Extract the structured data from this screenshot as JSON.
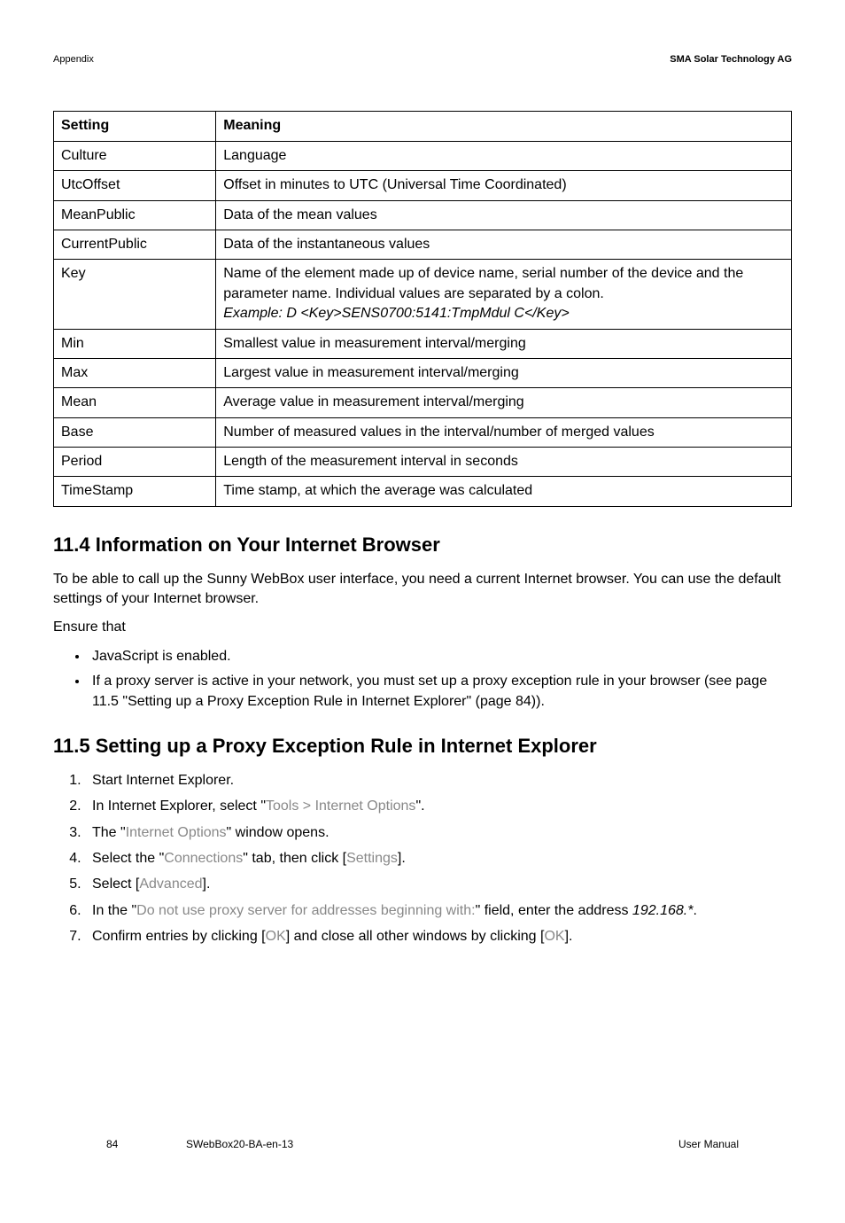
{
  "header": {
    "left": "Appendix",
    "right": "SMA Solar Technology AG"
  },
  "table": {
    "head": {
      "c1": "Setting",
      "c2": "Meaning"
    },
    "rows": [
      {
        "c1": "Culture",
        "c2": "Language"
      },
      {
        "c1": "UtcOffset",
        "c2": "Offset in minutes to UTC (Universal Time Coordinated)"
      },
      {
        "c1": "MeanPublic",
        "c2": "Data of the mean values"
      },
      {
        "c1": "CurrentPublic",
        "c2": "Data of the instantaneous values"
      },
      {
        "c1": "Key",
        "c2": "Name of the element made up of device name, serial number of the device and the parameter name. Individual values are separated by a colon.",
        "c2b": "Example: D <Key>SENS0700:5141:TmpMdul C</Key>"
      },
      {
        "c1": "Min",
        "c2": "Smallest value in measurement interval/merging"
      },
      {
        "c1": "Max",
        "c2": "Largest value in measurement interval/merging"
      },
      {
        "c1": "Mean",
        "c2": "Average value in measurement interval/merging"
      },
      {
        "c1": "Base",
        "c2": "Number of measured values in the interval/number of merged values"
      },
      {
        "c1": "Period",
        "c2": "Length of the measurement interval in seconds"
      },
      {
        "c1": "TimeStamp",
        "c2": "Time stamp, at which the average was calculated"
      }
    ]
  },
  "sec114": {
    "title": "11.4  Information on Your Internet Browser",
    "p1": "To be able to call up the Sunny WebBox user interface, you need a current Internet browser. You can use the default settings of your Internet browser.",
    "p2": "Ensure that",
    "b1": "JavaScript is enabled.",
    "b2": "If a proxy server is active in your network, you must set up a proxy exception rule in your browser (see page 11.5 \"Setting up a Proxy Exception Rule in Internet Explorer\" (page 84))."
  },
  "sec115": {
    "title": "11.5  Setting up a Proxy Exception Rule in Internet Explorer",
    "s1": "Start Internet Explorer.",
    "s2a": "In Internet Explorer, select \"",
    "s2b": "Tools > Internet Options",
    "s2c": "\".",
    "s3a": "The \"",
    "s3b": "Internet Options",
    "s3c": "\" window opens.",
    "s4a": "Select the \"",
    "s4b": "Connections",
    "s4c": "\" tab, then click [",
    "s4d": "Settings",
    "s4e": "].",
    "s5a": "Select [",
    "s5b": "Advanced",
    "s5c": "].",
    "s6a": "In the \"",
    "s6b": "Do not use proxy server for addresses beginning with:",
    "s6c": "\" field, enter the address ",
    "s6d": "192.168.*",
    "s6e": ".",
    "s7a": "Confirm entries by clicking [",
    "s7b": "OK",
    "s7c": "] and close all other windows by clicking [",
    "s7d": "OK",
    "s7e": "]."
  },
  "footer": {
    "left": "84",
    "mid": "SWebBox20-BA-en-13",
    "right": "User Manual"
  }
}
